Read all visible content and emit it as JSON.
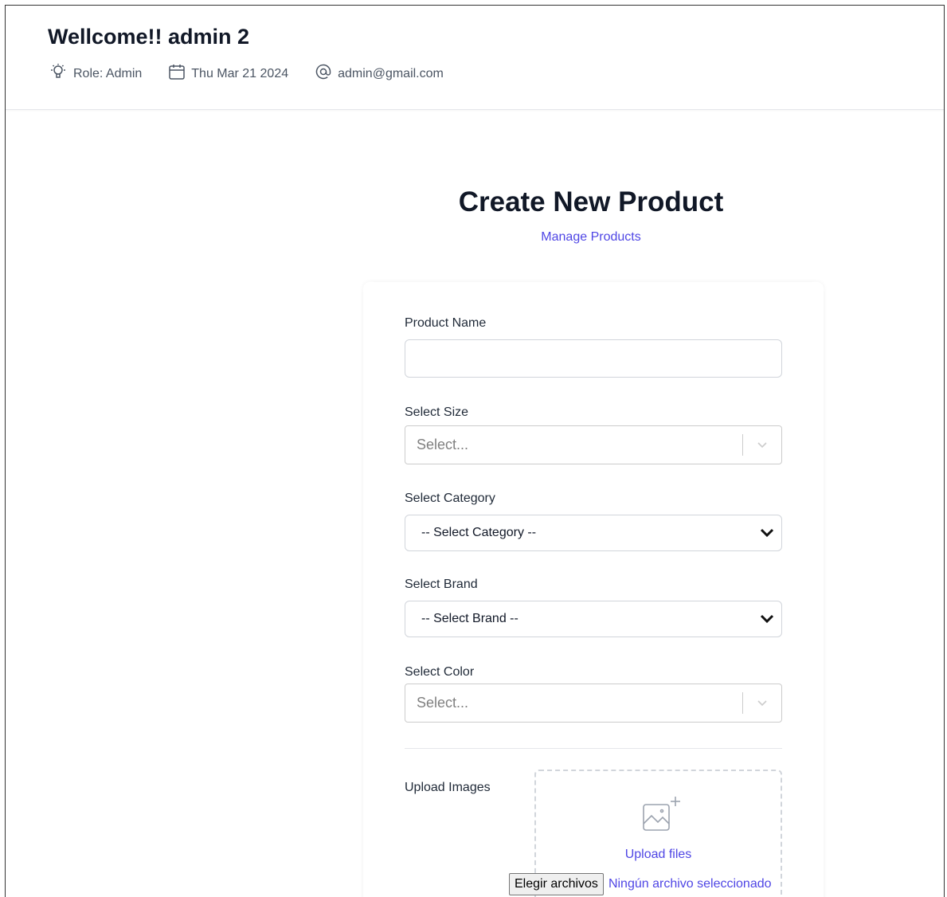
{
  "header": {
    "welcome": "Wellcome!! admin 2",
    "role": "Role: Admin",
    "date": "Thu Mar 21 2024",
    "email": "admin@gmail.com"
  },
  "page": {
    "title": "Create New Product",
    "manage_link": "Manage Products"
  },
  "form": {
    "product_name_label": "Product Name",
    "product_name_value": "",
    "size_label": "Select Size",
    "size_placeholder": "Select...",
    "category_label": "Select Category",
    "category_value": "-- Select Category --",
    "brand_label": "Select Brand",
    "brand_value": "-- Select Brand --",
    "color_label": "Select Color",
    "color_placeholder": "Select...",
    "upload_label": "Upload Images",
    "upload_files": "Upload files",
    "file_button": "Elegir archivos",
    "file_status": "Ningún archivo seleccionado"
  },
  "colors": {
    "accent": "#4f46e5",
    "text": "#111827",
    "border": "#d1d5db"
  },
  "icons": {
    "role": "lightbulb-icon",
    "date": "calendar-icon",
    "email": "at-sign-icon",
    "select_chevron": "chevron-down-icon",
    "upload": "image-plus-icon"
  }
}
